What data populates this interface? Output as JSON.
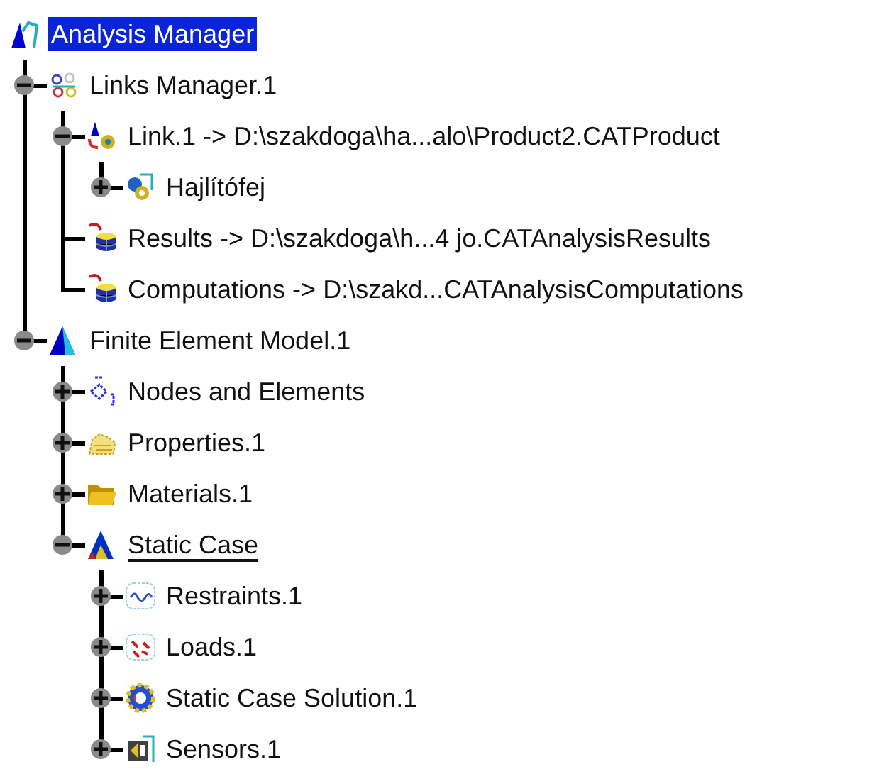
{
  "tree": {
    "label": "Analysis Manager",
    "kind": "analysis",
    "selected": true,
    "current": false,
    "children": [
      {
        "label": "Links Manager.1",
        "kind": "links",
        "selected": false,
        "current": false,
        "expanded": true,
        "children": [
          {
            "label": "Link.1 -> D:\\szakdoga\\ha...alo\\Product2.CATProduct",
            "kind": "link",
            "selected": false,
            "current": false,
            "expanded": true,
            "children": [
              {
                "label": "Hajlítófej",
                "kind": "product",
                "selected": false,
                "current": false,
                "expanded": false
              }
            ]
          },
          {
            "label": "Results -> D:\\szakdoga\\h...4 jo.CATAnalysisResults",
            "kind": "database",
            "selected": false,
            "current": false
          },
          {
            "label": "Computations -> D:\\szakd...CATAnalysisComputations",
            "kind": "database",
            "selected": false,
            "current": false
          }
        ]
      },
      {
        "label": "Finite Element Model.1",
        "kind": "model",
        "selected": false,
        "current": false,
        "expanded": true,
        "children": [
          {
            "label": "Nodes and Elements",
            "kind": "nodes",
            "selected": false,
            "current": false,
            "expanded": false
          },
          {
            "label": "Properties.1",
            "kind": "properties",
            "selected": false,
            "current": false,
            "expanded": false
          },
          {
            "label": "Materials.1",
            "kind": "materials",
            "selected": false,
            "current": false,
            "expanded": false
          },
          {
            "label": "Static Case",
            "kind": "case",
            "selected": false,
            "current": true,
            "expanded": true,
            "children": [
              {
                "label": "Restraints.1",
                "kind": "restraints",
                "selected": false,
                "current": false,
                "expanded": false
              },
              {
                "label": "Loads.1",
                "kind": "loads",
                "selected": false,
                "current": false,
                "expanded": false
              },
              {
                "label": "Static Case Solution.1",
                "kind": "solution",
                "selected": false,
                "current": false,
                "expanded": false
              },
              {
                "label": "Sensors.1",
                "kind": "sensors",
                "selected": false,
                "current": false,
                "expanded": false
              }
            ]
          }
        ]
      }
    ]
  }
}
